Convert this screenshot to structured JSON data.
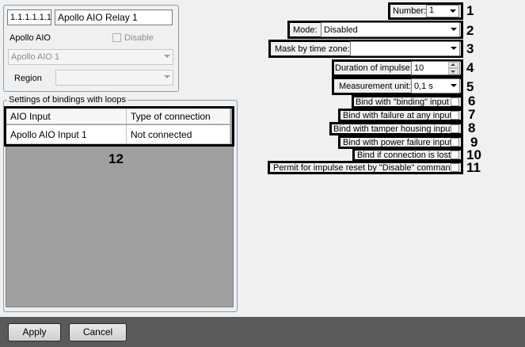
{
  "object": {
    "id": "1.1.1.1.1.1",
    "name": "Apollo AIO Relay 1",
    "parent_label": "Apollo AIO",
    "disable_label": "Disable",
    "parent_value": "Apollo AIO 1",
    "region_label": "Region",
    "region_value": ""
  },
  "bindings": {
    "group_title": "Settings of bindings with loops",
    "columns": [
      "AIO Input",
      "Type of connection"
    ],
    "rows": [
      {
        "input": "Apollo AIO Input 1",
        "connection": "Not connected"
      }
    ],
    "callout": "12"
  },
  "settings": {
    "number_label": "Number:",
    "number_value": "1",
    "mode_label": "Mode:",
    "mode_value": "Disabled",
    "mask_label": "Mask by time zone:",
    "mask_value": "",
    "duration_label": "Duration of impulse:",
    "duration_value": "10",
    "unit_label": "Measurement unit:",
    "unit_value": "0,1 s",
    "bind_binding_input": "Bind with \"binding\" input",
    "bind_failure_any": "Bind with failure at any input",
    "bind_tamper": "Bind with tamper housing input",
    "bind_power": "Bind with power failure input",
    "bind_conn_lost": "Bind if connection is lost",
    "permit_reset": "Permit for impulse reset by \"Disable\" command"
  },
  "callouts": [
    "1",
    "2",
    "3",
    "4",
    "5",
    "6",
    "7",
    "8",
    "9",
    "10",
    "11"
  ],
  "buttons": {
    "apply": "Apply",
    "cancel": "Cancel"
  }
}
